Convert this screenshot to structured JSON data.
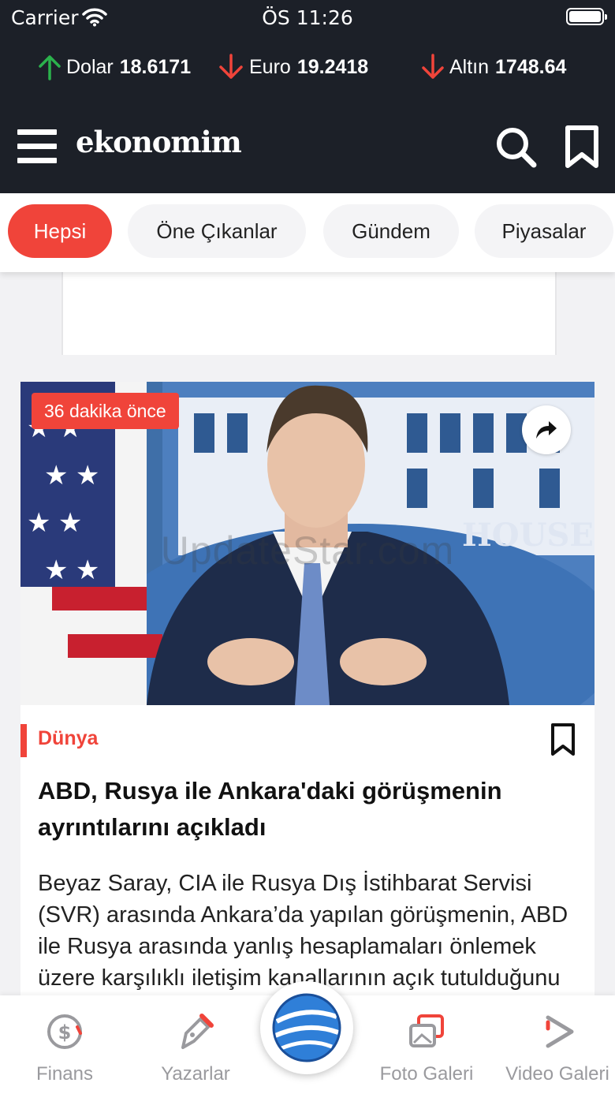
{
  "status_bar": {
    "carrier": "Carrier",
    "time": "ÖS 11:26"
  },
  "tickers": [
    {
      "name": "Dolar",
      "value": "18.6171",
      "direction": "up",
      "color": "#2bb24c"
    },
    {
      "name": "Euro",
      "value": "19.2418",
      "direction": "down",
      "color": "#f0443a"
    },
    {
      "name": "Altın",
      "value": "1748.64",
      "direction": "down",
      "color": "#f0443a"
    }
  ],
  "header": {
    "logo": "ekonomim"
  },
  "tabs": [
    {
      "label": "Hepsi",
      "active": true
    },
    {
      "label": "Öne Çıkanlar",
      "active": false
    },
    {
      "label": "Gündem",
      "active": false
    },
    {
      "label": "Piyasalar",
      "active": false
    }
  ],
  "article": {
    "time_ago": "36 dakika önce",
    "watermark": "UpdateStar.com",
    "category": "Dünya",
    "title": "ABD, Rusya ile Ankara'daki görüşmenin ayrıntılarını açıkladı",
    "summary": "Beyaz Saray, CIA ile Rusya Dış İstihbarat Servisi (SVR) arasında Ankara’da yapılan görüşmenin, ABD ile Rusya arasında yanlış hesaplamaları önlemek üzere karşılıklı iletişim kanallarının açık tutulduğunu açıkladı."
  },
  "bottom_nav": [
    {
      "label": "Finans",
      "icon": "finance-icon"
    },
    {
      "label": "Yazarlar",
      "icon": "pen-icon"
    },
    {
      "label": "Foto Galeri",
      "icon": "photo-gallery-icon"
    },
    {
      "label": "Video Galeri",
      "icon": "video-gallery-icon"
    }
  ],
  "colors": {
    "header_bg": "#1c2028",
    "accent": "#f0443a",
    "up": "#2bb24c"
  }
}
